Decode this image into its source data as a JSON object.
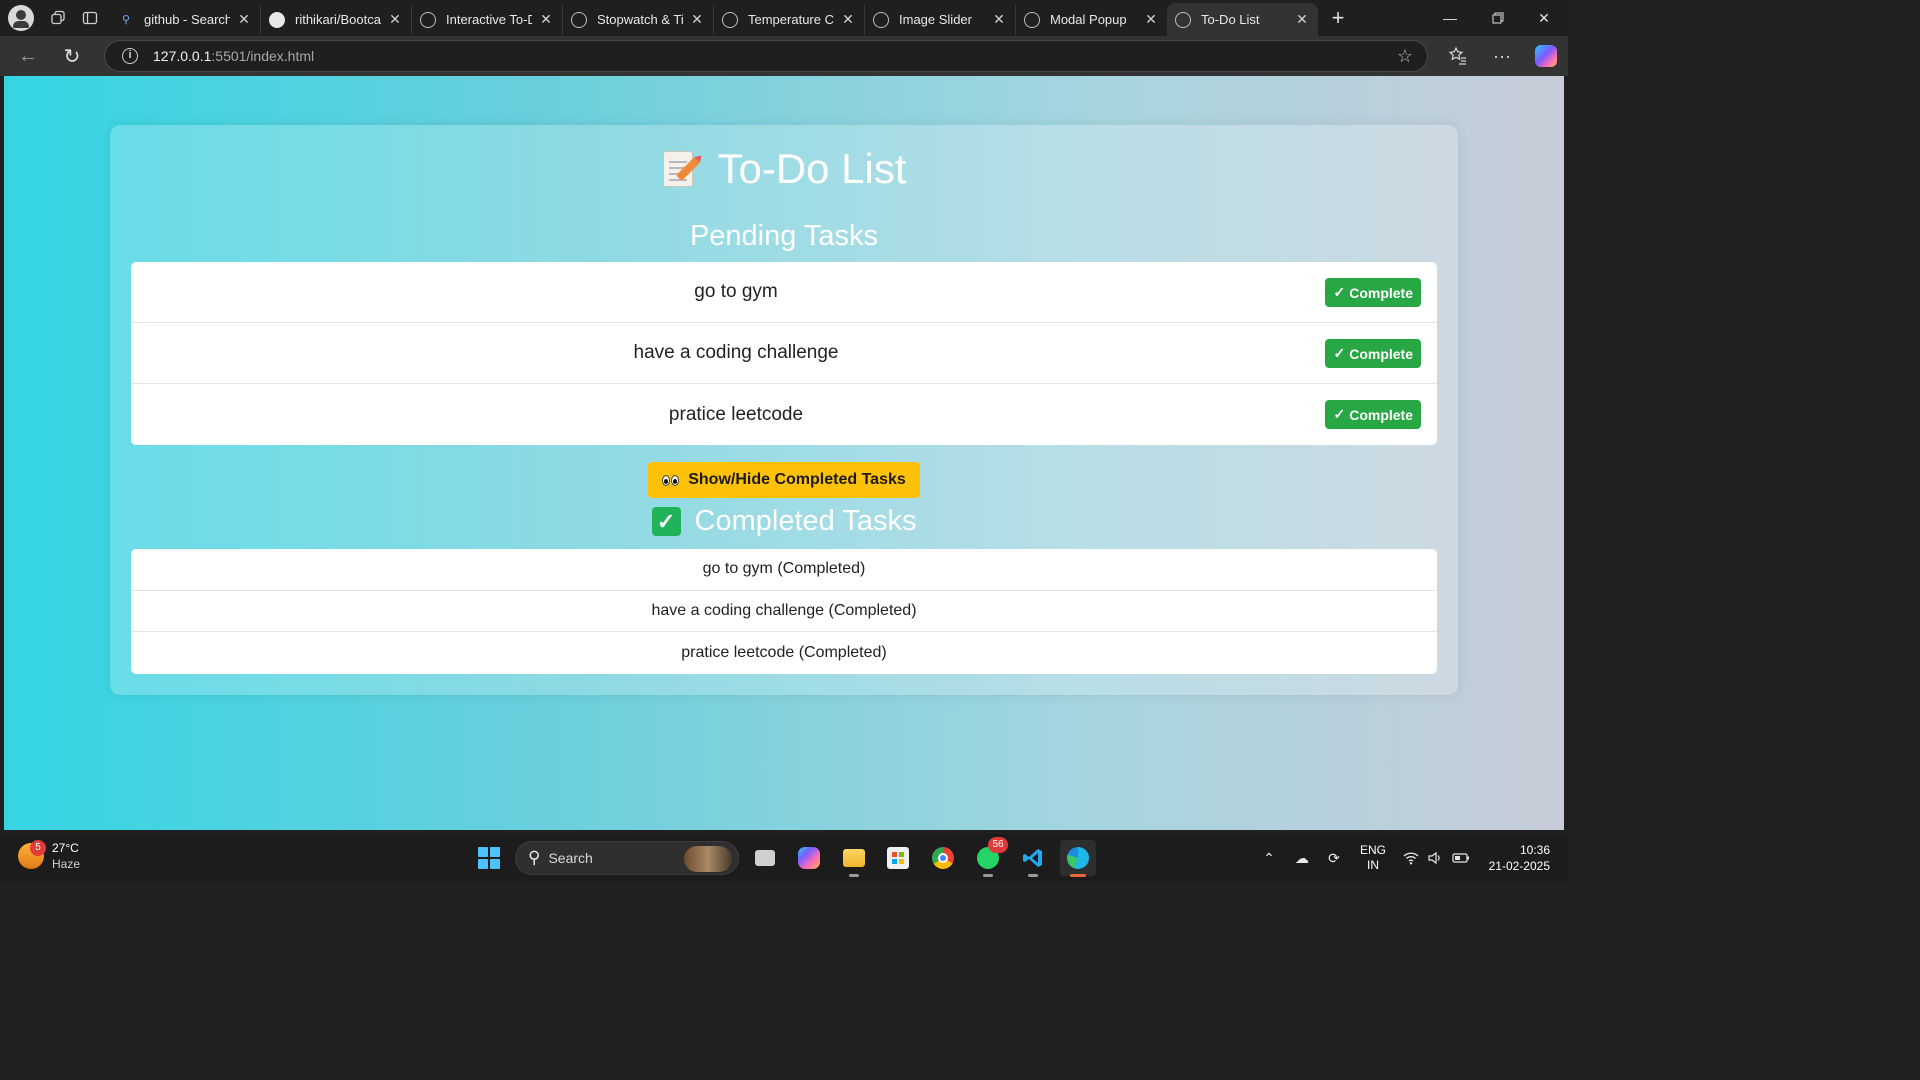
{
  "browser": {
    "tabs": [
      {
        "label": "github - Search",
        "icon": "search-icon"
      },
      {
        "label": "rithikari/Bootcam",
        "icon": "github-icon"
      },
      {
        "label": "Interactive To-Do",
        "icon": "globe-icon"
      },
      {
        "label": "Stopwatch & Tim",
        "icon": "globe-icon"
      },
      {
        "label": "Temperature Con",
        "icon": "globe-icon"
      },
      {
        "label": "Image Slider",
        "icon": "globe-icon"
      },
      {
        "label": "Modal Popup",
        "icon": "globe-icon"
      },
      {
        "label": "To-Do List",
        "icon": "globe-icon",
        "active": true
      }
    ],
    "url_host": "127.0.0.1",
    "url_path": ":5501/index.html"
  },
  "page": {
    "title": "To-Do List",
    "pending_heading": "Pending Tasks",
    "complete_label": "Complete",
    "complete_check": "✓",
    "pending_tasks": [
      "go to gym",
      "have a coding challenge",
      "pratice leetcode"
    ],
    "toggle_label": "Show/Hide Completed Tasks",
    "completed_heading": "Completed Tasks",
    "completed_tasks": [
      "go to gym (Completed)",
      "have a coding challenge (Completed)",
      "pratice leetcode (Completed)"
    ]
  },
  "taskbar": {
    "weather_temp": "27°C",
    "weather_desc": "Haze",
    "weather_badge": "5",
    "search_label": "Search",
    "whatsapp_badge": "56",
    "lang_line1": "ENG",
    "lang_line2": "IN",
    "time": "10:36",
    "date": "21-02-2025"
  },
  "colors": {
    "complete_button": "#28a745",
    "toggle_button": "#ffc107",
    "gradient_start": "#34d5e2",
    "gradient_end": "#c7ccd8"
  }
}
